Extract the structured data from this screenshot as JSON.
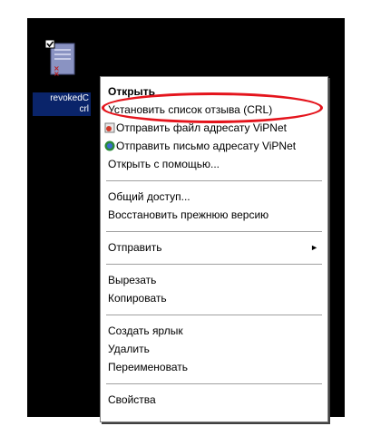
{
  "desktop_file": {
    "icon": "certificate-file-icon",
    "name_line1": "revokedC",
    "name_line2": "crl",
    "checkbox_icon": "checkbox-checked-icon"
  },
  "context_menu": {
    "group1": {
      "open": "Открыть",
      "install_crl": "Установить список отзыва (CRL)",
      "send_file_vipnet": "Отправить файл адресату ViPNet",
      "send_letter_vipnet": "Отправить письмо адресату ViPNet",
      "open_with": "Открыть с помощью..."
    },
    "group2": {
      "sharing": "Общий доступ...",
      "restore_previous": "Восстановить прежнюю версию"
    },
    "group3": {
      "send_to": "Отправить",
      "send_to_arrow": "►"
    },
    "group4": {
      "cut": "Вырезать",
      "copy": "Копировать"
    },
    "group5": {
      "create_shortcut": "Создать ярлык",
      "delete": "Удалить",
      "rename": "Переименовать"
    },
    "group6": {
      "properties": "Свойства"
    }
  },
  "colors": {
    "desktop_bg": "#000000",
    "selection_bg": "#0a246a",
    "highlight_ellipse": "#e4141c"
  }
}
